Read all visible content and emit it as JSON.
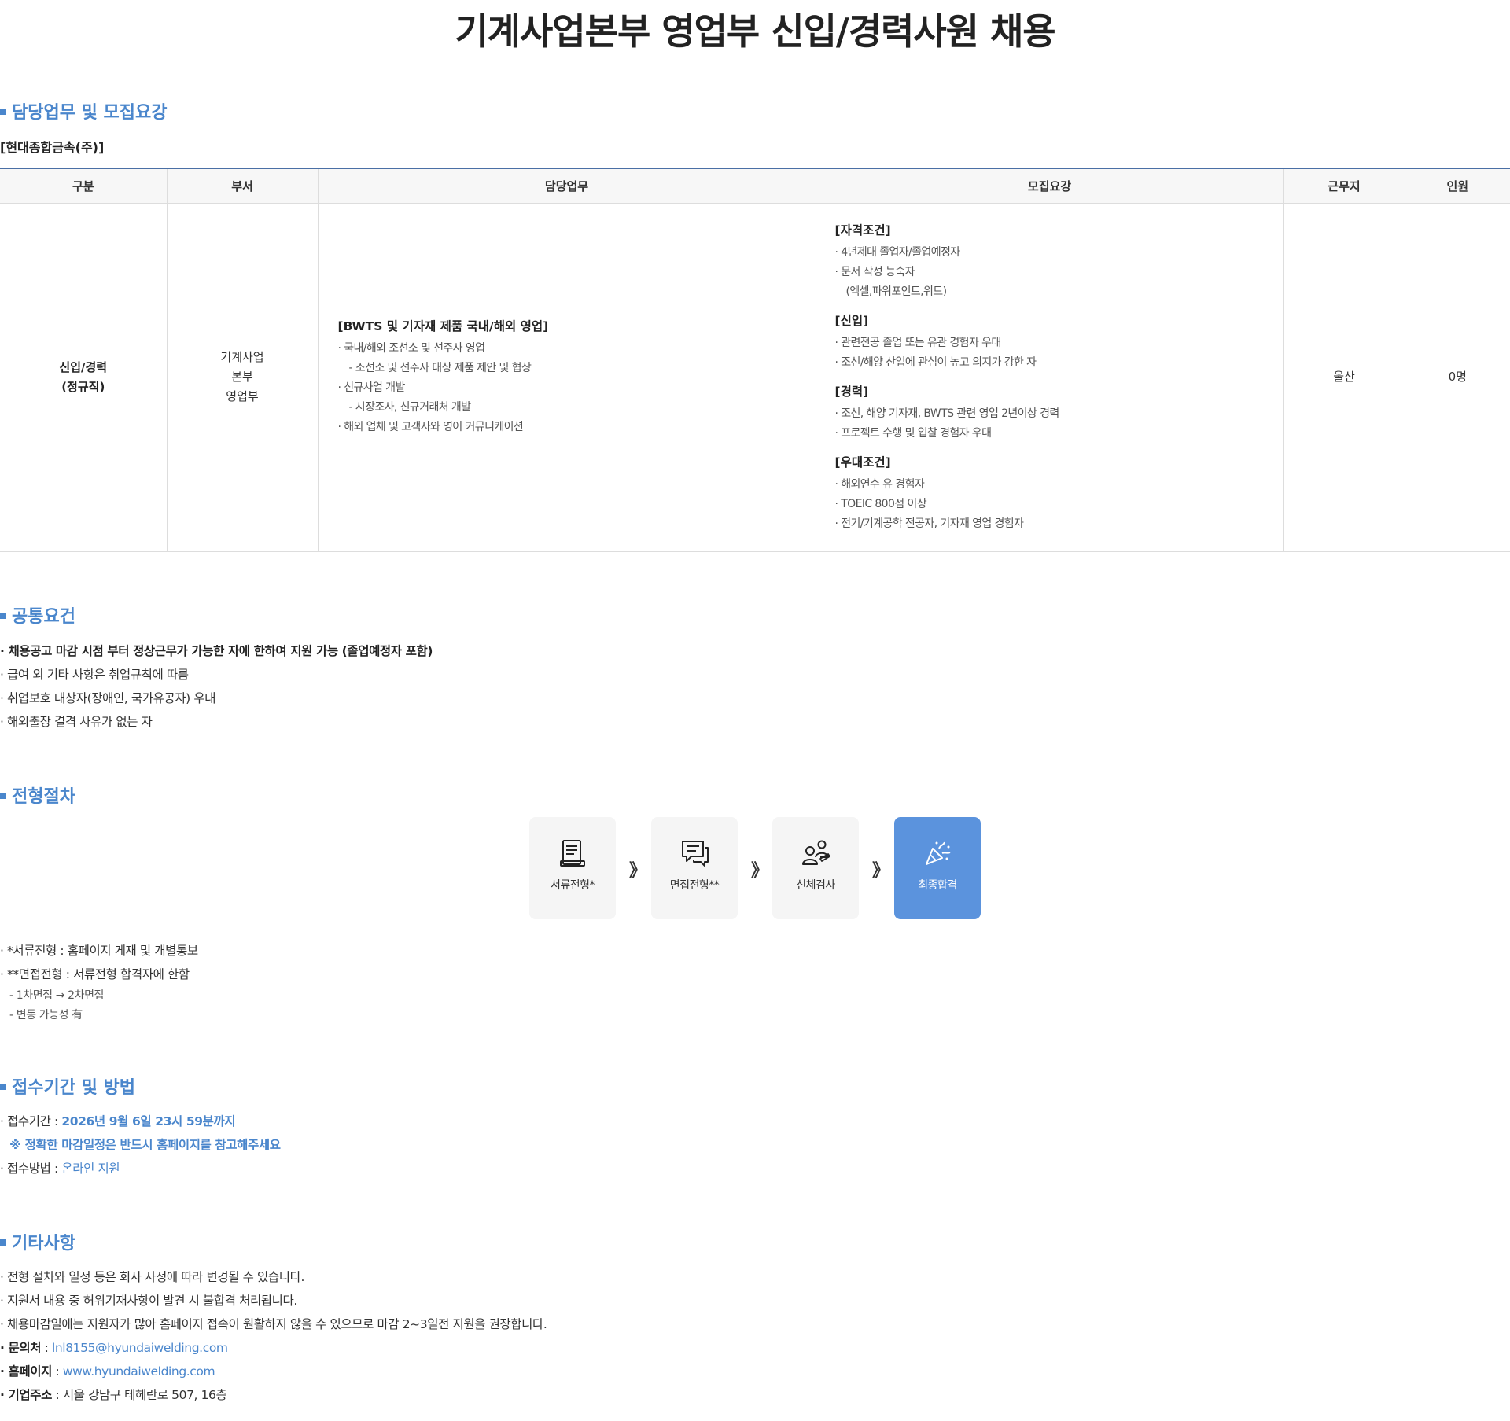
{
  "page_title": "기계사업본부 영업부 신입/경력사원 채용",
  "sections": {
    "duties": "담당업무 및 모집요강",
    "common": "공통요건",
    "process": "전형절차",
    "apply": "접수기간 및 방법",
    "etc": "기타사항"
  },
  "company": "[현대종합금속(주)]",
  "table": {
    "headers": [
      "구분",
      "부서",
      "담당업무",
      "모집요강",
      "근무지",
      "인원"
    ],
    "type": [
      "신입/경력",
      "(정규직)"
    ],
    "dept": [
      "기계사업",
      "본부",
      "영업부"
    ],
    "duty_title": "[BWTS 및 기자재 제품 국내/해외 영업]",
    "duty_lines": [
      "· 국내/해외 조선소 및 선주사 영업",
      "- 조선소 및 선주사 대상 제품 제안 및 협상",
      "· 신규사업 개발",
      "- 시장조사, 신규거래처 개발",
      "· 해외 업체 및 고객사와 영어 커뮤니케이션"
    ],
    "requirements": [
      {
        "title": "[자격조건]",
        "lines": [
          "· 4년제대 졸업자/졸업예정자",
          "· 문서 작성 능숙자",
          "(엑셀,파워포인트,워드)"
        ]
      },
      {
        "title": "[신입]",
        "lines": [
          "· 관련전공 졸업 또는 유관 경험자 우대",
          "· 조선/해양 산업에 관심이 높고 의지가 강한 자"
        ]
      },
      {
        "title": "[경력]",
        "lines": [
          "· 조선, 해양 기자재, BWTS 관련 영업 2년이상 경력",
          "· 프로젝트 수행 및 입찰 경험자 우대"
        ]
      },
      {
        "title": "[우대조건]",
        "lines": [
          "· 해외연수 유 경험자",
          "· TOEIC 800점 이상",
          "· 전기/기계공학 전공자, 기자재 영업 경험자"
        ]
      }
    ],
    "location": "울산",
    "headcount": "0명"
  },
  "common_lines": [
    "· 채용공고 마감 시점 부터 정상근무가 가능한 자에 한하여 지원 가능 (졸업예정자 포함)",
    "· 급여 외 기타 사항은 취업규칙에 따름",
    "· 취업보호 대상자(장애인, 국가유공자) 우대",
    "· 해외출장 결격 사유가 없는 자"
  ],
  "process": {
    "steps": [
      {
        "label": "서류전형*",
        "icon": "document-icon"
      },
      {
        "label": "면접전형**",
        "icon": "interview-chat-icon"
      },
      {
        "label": "신체검사",
        "icon": "medical-check-icon"
      },
      {
        "label": "최종합격",
        "icon": "celebration-icon"
      }
    ],
    "arrow": "》",
    "notes": [
      "· *서류전형 : 홈페이지 게재 및 개별통보",
      "· **면접전형 : 서류전형 합격자에 한함"
    ],
    "subnotes": [
      "- 1차면접 → 2차면접",
      "- 변동 가능성 有"
    ]
  },
  "apply": {
    "period_label": "· 접수기간 : ",
    "period_value": "2026년 9월 6일 23시 59분까지",
    "note": "※ 정확한 마감일정은 반드시 홈페이지를 참고해주세요",
    "method_label": "· 접수방법 : ",
    "method_value": "온라인 지원"
  },
  "etc": {
    "lines": [
      "· 전형 절차와 일정 등은 회사 사정에 따라 변경될 수 있습니다.",
      "· 지원서 내용 중 허위기재사항이 발견 시 불합격 처리됩니다.",
      "· 채용마감일에는 지원자가 많아 홈페이지 접속이 원활하지 않을 수 있으므로 마감 2~3일전 지원을 권장합니다."
    ],
    "contact_label": "· 문의처",
    "contact_value": "lnl8155@hyundaiwelding.com",
    "homepage_label": "· 홈페이지",
    "homepage_value": "www.hyundaiwelding.com",
    "address_label": "· 기업주소",
    "address_value": "서울 강남구 테헤란로 507, 16층",
    "separator": " : "
  },
  "colors": {
    "accent": "#4a86cc",
    "final_step": "#5b93dd",
    "table_top": "#4a6fa5"
  }
}
